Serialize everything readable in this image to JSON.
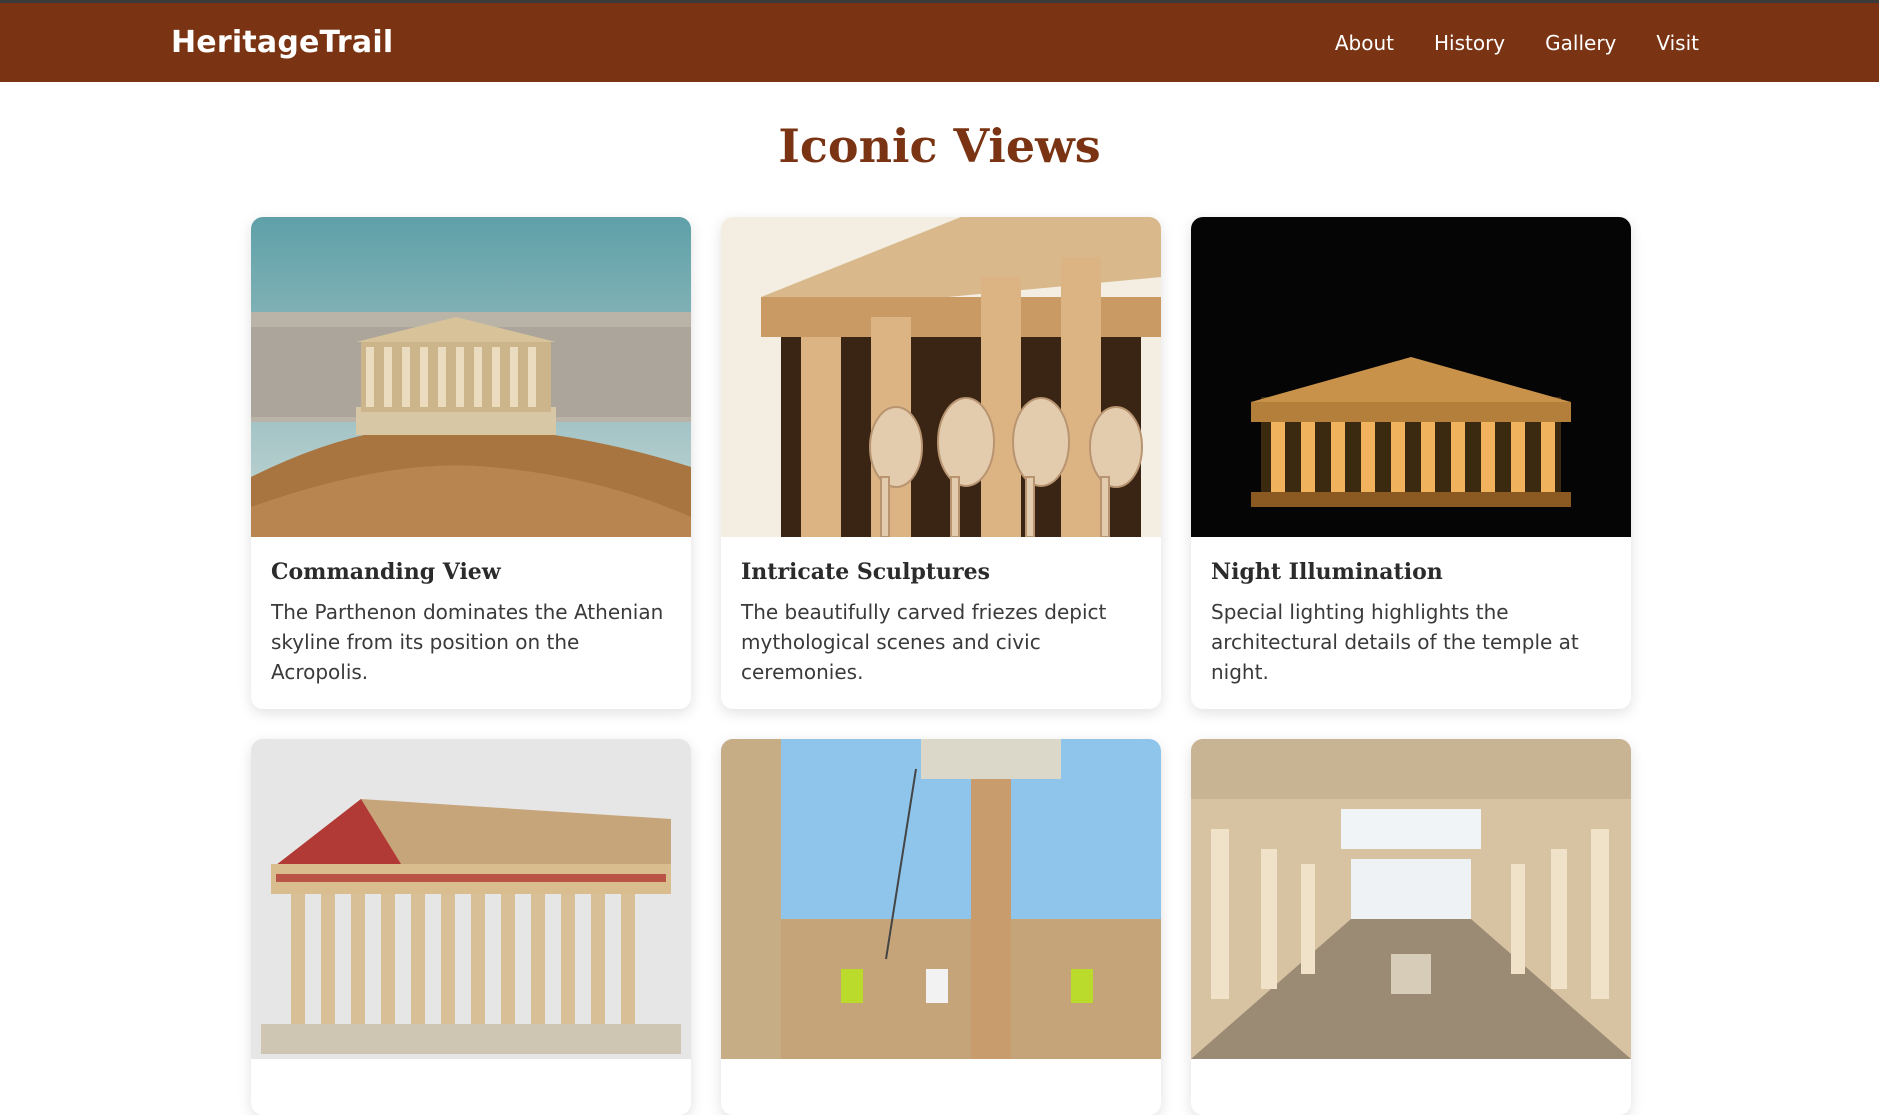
{
  "header": {
    "brand": "HeritageTrail",
    "nav": [
      "About",
      "History",
      "Gallery",
      "Visit"
    ]
  },
  "section": {
    "title": "Iconic Views"
  },
  "cards": [
    {
      "title": "Commanding View",
      "text": "The Parthenon dominates the Athenian skyline from its position on the Acropolis."
    },
    {
      "title": "Intricate Sculptures",
      "text": "The beautifully carved friezes depict mythological scenes and civic ceremonies."
    },
    {
      "title": "Night Illumination",
      "text": "Special lighting highlights the architectural details of the temple at night."
    },
    {
      "title": "",
      "text": ""
    },
    {
      "title": "",
      "text": ""
    },
    {
      "title": "",
      "text": ""
    }
  ],
  "colors": {
    "brand": "#7a3413",
    "topbar": "#3a3a3a"
  }
}
